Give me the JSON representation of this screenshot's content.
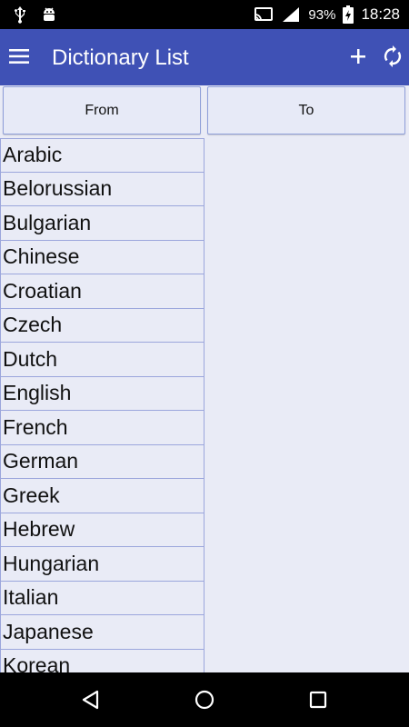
{
  "status_bar": {
    "battery_percent": "93%",
    "time": "18:28",
    "icons": [
      "usb-icon",
      "android-debug-icon",
      "cast-icon",
      "signal-icon",
      "battery-charging-icon"
    ]
  },
  "app_bar": {
    "title": "Dictionary List",
    "icons": [
      "menu-icon",
      "add-icon",
      "refresh-icon"
    ],
    "color": "#3f51b5"
  },
  "tabs": {
    "from_label": "From",
    "to_label": "To"
  },
  "languages": [
    "Arabic",
    "Belorussian",
    "Bulgarian",
    "Chinese",
    "Croatian",
    "Czech",
    "Dutch",
    "English",
    "French",
    "German",
    "Greek",
    "Hebrew",
    "Hungarian",
    "Italian",
    "Japanese",
    "Korean"
  ],
  "nav_bar": {
    "icons": [
      "back-icon",
      "home-icon",
      "recents-icon"
    ]
  },
  "colors": {
    "background": "#e9ebf6",
    "list_border": "#9ba6dc"
  }
}
